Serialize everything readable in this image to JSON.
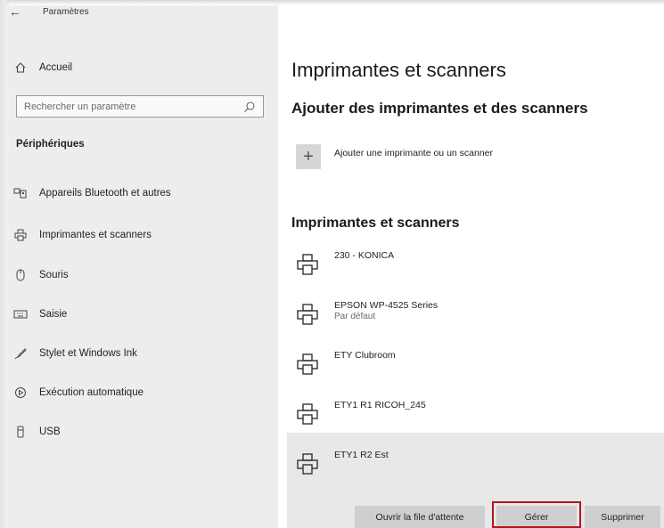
{
  "window": {
    "title": "Paramètres",
    "back_icon": "back-arrow-icon"
  },
  "sidebar": {
    "home_label": "Accueil",
    "search_placeholder": "Rechercher un paramètre",
    "section_title": "Périphériques",
    "items": [
      {
        "label": "Appareils Bluetooth et autres",
        "icon": "bluetooth-devices-icon"
      },
      {
        "label": "Imprimantes et scanners",
        "icon": "printer-icon"
      },
      {
        "label": "Souris",
        "icon": "mouse-icon"
      },
      {
        "label": "Saisie",
        "icon": "keyboard-icon"
      },
      {
        "label": "Stylet et Windows Ink",
        "icon": "pen-icon"
      },
      {
        "label": "Exécution automatique",
        "icon": "autoplay-icon"
      },
      {
        "label": "USB",
        "icon": "usb-icon"
      }
    ]
  },
  "main": {
    "page_title": "Imprimantes et scanners",
    "add_section_title": "Ajouter des imprimantes et des scanners",
    "add_label": "Ajouter une imprimante ou un scanner",
    "list_title": "Imprimantes et scanners",
    "printers": [
      {
        "name": "230 - KONICA",
        "status": ""
      },
      {
        "name": "EPSON WP-4525 Series",
        "status": "Par défaut"
      },
      {
        "name": "ETY Clubroom",
        "status": ""
      },
      {
        "name": "ETY1 R1 RICOH_245",
        "status": ""
      },
      {
        "name": "ETY1 R2 Est",
        "status": ""
      }
    ],
    "buttons": {
      "open_queue": "Ouvrir la file d'attente",
      "manage": "Gérer",
      "remove": "Supprimer"
    },
    "highlight_color": "#b5161b"
  }
}
